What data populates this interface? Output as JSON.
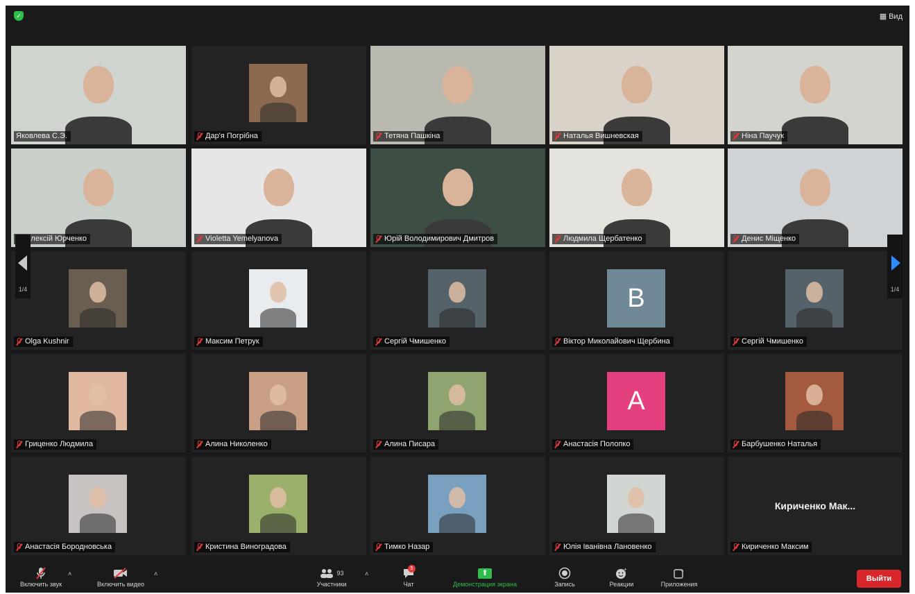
{
  "topbar": {
    "view_label": "Вид"
  },
  "participants": [
    {
      "name": "Яковлева С.Э.",
      "kind": "video",
      "bg": "#cfd4cf",
      "active": true
    },
    {
      "name": "Дар'я Погрібна",
      "kind": "photo",
      "bg": "#8b6a4f"
    },
    {
      "name": "Тетяна Пашкіна",
      "kind": "video",
      "bg": "#b9b9b0"
    },
    {
      "name": "Наталья Вишневская",
      "kind": "video",
      "bg": "#d8d2c8"
    },
    {
      "name": "Ніна Паучук",
      "kind": "video",
      "bg": "#d4d4cf"
    },
    {
      "name": "Олексій Юрченко",
      "kind": "video",
      "bg": "#c9cfc9"
    },
    {
      "name": "Violetta Yemelyanova",
      "kind": "video",
      "bg": "#e6e6e6"
    },
    {
      "name": "Юрій Володимирович Дмитров",
      "kind": "video",
      "bg": "#3d4f45"
    },
    {
      "name": "Людмила Щербатенко",
      "kind": "video",
      "bg": "#e4e2dc"
    },
    {
      "name": "Денис Міщенко",
      "kind": "video",
      "bg": "#cfd3d6"
    },
    {
      "name": "Olga Kushnir",
      "kind": "photo",
      "bg": "#6a5e50"
    },
    {
      "name": "Максим Петрук",
      "kind": "photo",
      "bg": "#e8ecee"
    },
    {
      "name": "Сергій Чмишенко",
      "kind": "photo",
      "bg": "#55626a"
    },
    {
      "name": "Віктор Миколайович Щербина",
      "kind": "letter",
      "letter": "B",
      "bg": "#6f8a96"
    },
    {
      "name": "Сергій Чмишенко",
      "kind": "photo",
      "bg": "#55626a"
    },
    {
      "name": "Гриценко Людмила",
      "kind": "photo",
      "bg": "#e0b9a0"
    },
    {
      "name": "Алина Николенко",
      "kind": "photo",
      "bg": "#c99f86"
    },
    {
      "name": "Алина Писара",
      "kind": "photo",
      "bg": "#8fa46f"
    },
    {
      "name": "Анастасія Полопко",
      "kind": "letter",
      "letter": "A",
      "bg": "#e43f7e"
    },
    {
      "name": "Барбушенко Наталья",
      "kind": "photo",
      "bg": "#a35a3e"
    },
    {
      "name": "Анастасія Бородновська",
      "kind": "photo",
      "bg": "#c8c2c0"
    },
    {
      "name": "Кристина Виноградова",
      "kind": "photo",
      "bg": "#9bb06a"
    },
    {
      "name": "Тимко Назар",
      "kind": "photo",
      "bg": "#7aa0c0"
    },
    {
      "name": "Юлія Іванівна Лановенко",
      "kind": "photo",
      "bg": "#d2d6d2"
    },
    {
      "name": "Кириченко Максим",
      "kind": "text",
      "big_text": "Кириченко Мак...",
      "bg": "#232323"
    }
  ],
  "pager": {
    "left_page": "1/4",
    "right_page": "1/4"
  },
  "toolbar": {
    "audio_label": "Включить звук",
    "video_label": "Включить видео",
    "participants_label": "Участники",
    "participants_count": "93",
    "chat_label": "Чат",
    "chat_badge": "5",
    "share_label": "Демонстрация экрана",
    "record_label": "Запись",
    "reactions_label": "Реакции",
    "apps_label": "Приложения",
    "exit_label": "Выйти"
  },
  "colors": {
    "background": "#1a1a1a",
    "tile": "#232323",
    "active_border": "#d8d43a",
    "accent_green": "#2ebd4a",
    "exit_red": "#d9262b",
    "mute_red": "#e23a3a"
  }
}
